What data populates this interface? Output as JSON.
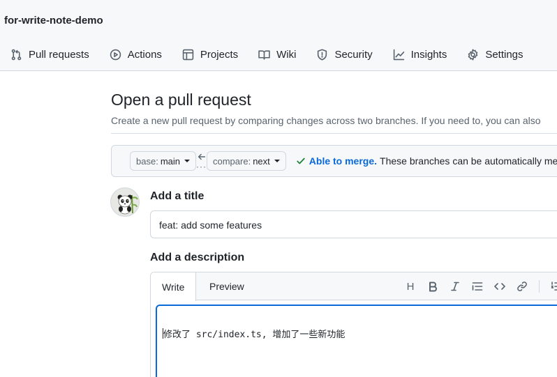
{
  "repo": {
    "name": "for-write-note-demo"
  },
  "nav": [
    {
      "label": "Pull requests",
      "icon": "pull-request-icon"
    },
    {
      "label": "Actions",
      "icon": "play-circle-icon"
    },
    {
      "label": "Projects",
      "icon": "table-icon"
    },
    {
      "label": "Wiki",
      "icon": "book-icon"
    },
    {
      "label": "Security",
      "icon": "shield-icon"
    },
    {
      "label": "Insights",
      "icon": "graph-icon"
    },
    {
      "label": "Settings",
      "icon": "gear-icon"
    }
  ],
  "page": {
    "title": "Open a pull request",
    "subtitle": "Create a new pull request by comparing changes across two branches. If you need to, you can also"
  },
  "compare": {
    "base_prefix": "base:",
    "base_value": "main",
    "compare_prefix": "compare:",
    "compare_value": "next",
    "status_strong": "Able to merge.",
    "status_text": "These branches can be automatically merged."
  },
  "form": {
    "title_label": "Add a title",
    "title_value": "feat: add some features",
    "description_label": "Add a description",
    "tab_write": "Write",
    "tab_preview": "Preview",
    "heading_tool": "H",
    "description_value": "修改了 src/index.ts, 增加了一些新功能"
  },
  "colors": {
    "accent": "#0969da",
    "success": "#1a7f37",
    "border": "#d0d7de",
    "header_bg": "#f6f8fa"
  }
}
